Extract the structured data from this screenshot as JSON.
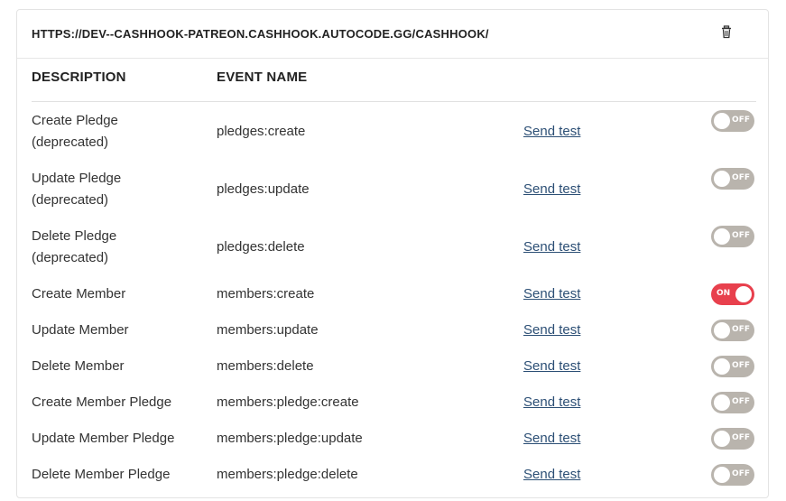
{
  "header": {
    "url": "HTTPS://DEV--CASHHOOK-PATREON.CASHHOOK.AUTOCODE.GG/CASHHOOK/",
    "delete_icon": "trash-icon"
  },
  "columns": {
    "description": "DESCRIPTION",
    "event_name": "EVENT NAME"
  },
  "rows": [
    {
      "desc1": "Create Pledge",
      "desc2": "(deprecated)",
      "event": "pledges:create",
      "send": "Send test",
      "toggle": "OFF",
      "enabled": false
    },
    {
      "desc1": "Update Pledge",
      "desc2": "(deprecated)",
      "event": "pledges:update",
      "send": "Send test",
      "toggle": "OFF",
      "enabled": false
    },
    {
      "desc1": "Delete Pledge",
      "desc2": "(deprecated)",
      "event": "pledges:delete",
      "send": "Send test",
      "toggle": "OFF",
      "enabled": false
    },
    {
      "desc1": "Create Member",
      "desc2": "",
      "event": "members:create",
      "send": "Send test",
      "toggle": "ON",
      "enabled": true
    },
    {
      "desc1": "Update Member",
      "desc2": "",
      "event": "members:update",
      "send": "Send test",
      "toggle": "OFF",
      "enabled": false
    },
    {
      "desc1": "Delete Member",
      "desc2": "",
      "event": "members:delete",
      "send": "Send test",
      "toggle": "OFF",
      "enabled": false
    },
    {
      "desc1": "Create Member Pledge",
      "desc2": "",
      "event": "members:pledge:create",
      "send": "Send test",
      "toggle": "OFF",
      "enabled": false
    },
    {
      "desc1": "Update Member Pledge",
      "desc2": "",
      "event": "members:pledge:update",
      "send": "Send test",
      "toggle": "OFF",
      "enabled": false
    },
    {
      "desc1": "Delete Member Pledge",
      "desc2": "",
      "event": "members:pledge:delete",
      "send": "Send test",
      "toggle": "OFF",
      "enabled": false
    }
  ],
  "colors": {
    "toggle_on": "#e8404d",
    "toggle_off": "#b9b4ad",
    "link": "#2c4f75"
  }
}
